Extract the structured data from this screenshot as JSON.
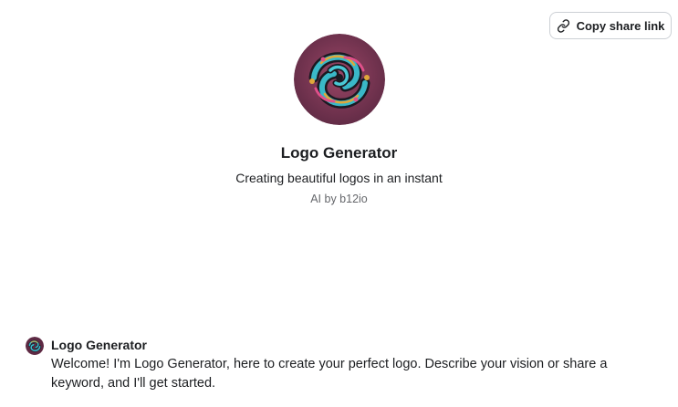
{
  "share": {
    "label": "Copy share link",
    "icon": "link-icon"
  },
  "bot": {
    "name": "Logo Generator",
    "tagline": "Creating beautiful logos in an instant",
    "author": "AI by b12io",
    "avatar_icon": "swirl-logo-avatar"
  },
  "message": {
    "sender": "Logo Generator",
    "text": "Welcome! I'm Logo Generator, here to create your perfect logo. Describe your vision or share a keyword, and I'll get started."
  },
  "colors": {
    "avatar_bg": "#7a3551",
    "swirl_cyan": "#3ab8c8",
    "swirl_gold": "#e0a83a",
    "swirl_pink": "#e0508a",
    "muted_text": "#65676b",
    "border": "#ccd0d5"
  }
}
